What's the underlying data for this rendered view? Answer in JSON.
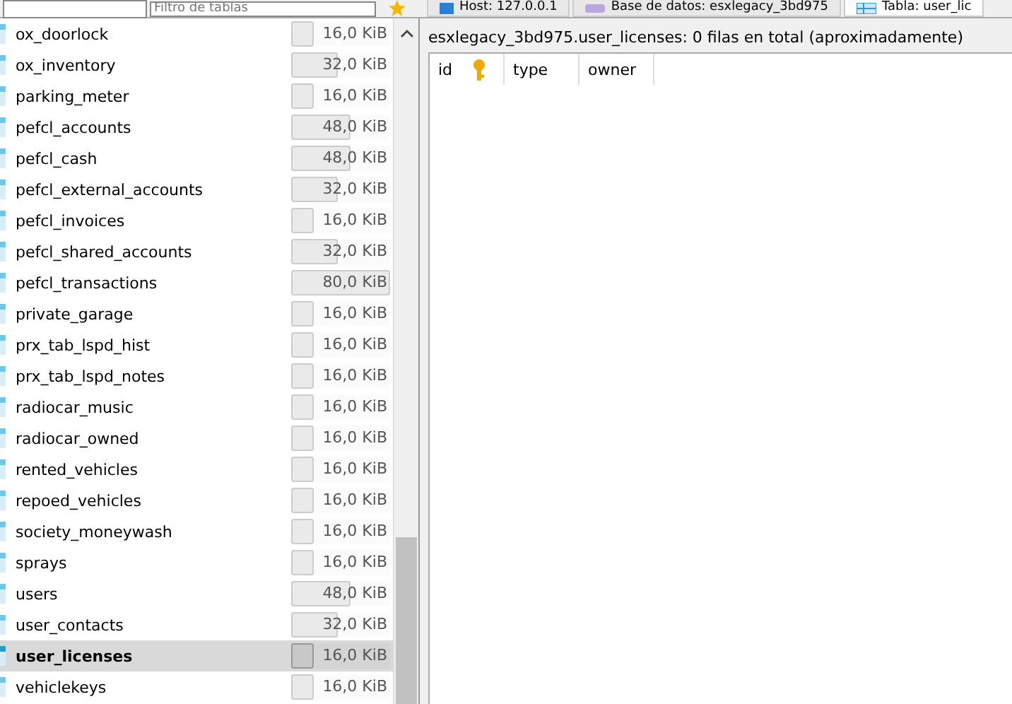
{
  "top_bar": {
    "table_filter": {
      "placeholder": "Filtro de tablas"
    },
    "tabs": [
      {
        "label": "Host: 127.0.0.1",
        "kind": "host",
        "selected": false
      },
      {
        "label": "Base de datos: esxlegacy_3bd975",
        "kind": "database",
        "selected": false
      },
      {
        "label": "Tabla: user_lic",
        "kind": "table",
        "selected": true
      }
    ]
  },
  "tables": [
    {
      "name": "ox_doorlock",
      "size": "16,0 KiB",
      "level": 0.23,
      "selected": false
    },
    {
      "name": "ox_inventory",
      "size": "32,0 KiB",
      "level": 0.47,
      "selected": false
    },
    {
      "name": "parking_meter",
      "size": "16,0 KiB",
      "level": 0.23,
      "selected": false
    },
    {
      "name": "pefcl_accounts",
      "size": "48,0 KiB",
      "level": 0.6,
      "selected": false
    },
    {
      "name": "pefcl_cash",
      "size": "48,0 KiB",
      "level": 0.6,
      "selected": false
    },
    {
      "name": "pefcl_external_accounts",
      "size": "32,0 KiB",
      "level": 0.47,
      "selected": false
    },
    {
      "name": "pefcl_invoices",
      "size": "16,0 KiB",
      "level": 0.23,
      "selected": false
    },
    {
      "name": "pefcl_shared_accounts",
      "size": "32,0 KiB",
      "level": 0.47,
      "selected": false
    },
    {
      "name": "pefcl_transactions",
      "size": "80,0 KiB",
      "level": 1,
      "selected": false
    },
    {
      "name": "private_garage",
      "size": "16,0 KiB",
      "level": 0.23,
      "selected": false
    },
    {
      "name": "prx_tab_lspd_hist",
      "size": "16,0 KiB",
      "level": 0.23,
      "selected": false
    },
    {
      "name": "prx_tab_lspd_notes",
      "size": "16,0 KiB",
      "level": 0.23,
      "selected": false
    },
    {
      "name": "radiocar_music",
      "size": "16,0 KiB",
      "level": 0.23,
      "selected": false
    },
    {
      "name": "radiocar_owned",
      "size": "16,0 KiB",
      "level": 0.23,
      "selected": false
    },
    {
      "name": "rented_vehicles",
      "size": "16,0 KiB",
      "level": 0.23,
      "selected": false
    },
    {
      "name": "repoed_vehicles",
      "size": "16,0 KiB",
      "level": 0.23,
      "selected": false
    },
    {
      "name": "society_moneywash",
      "size": "16,0 KiB",
      "level": 0.23,
      "selected": false
    },
    {
      "name": "sprays",
      "size": "16,0 KiB",
      "level": 0.23,
      "selected": false
    },
    {
      "name": "users",
      "size": "48,0 KiB",
      "level": 0.6,
      "selected": false
    },
    {
      "name": "user_contacts",
      "size": "32,0 KiB",
      "level": 0.47,
      "selected": false
    },
    {
      "name": "user_licenses",
      "size": "16,0 KiB",
      "level": 0.23,
      "selected": true
    },
    {
      "name": "vehiclekeys",
      "size": "16,0 KiB",
      "level": 0.23,
      "selected": false
    }
  ],
  "data_view": {
    "summary": "esxlegacy_3bd975.user_licenses: 0 filas en total (aproximadamente)",
    "columns": [
      {
        "label": "id",
        "primary_key": true
      },
      {
        "label": "type",
        "primary_key": false
      },
      {
        "label": "owner",
        "primary_key": false
      }
    ]
  }
}
